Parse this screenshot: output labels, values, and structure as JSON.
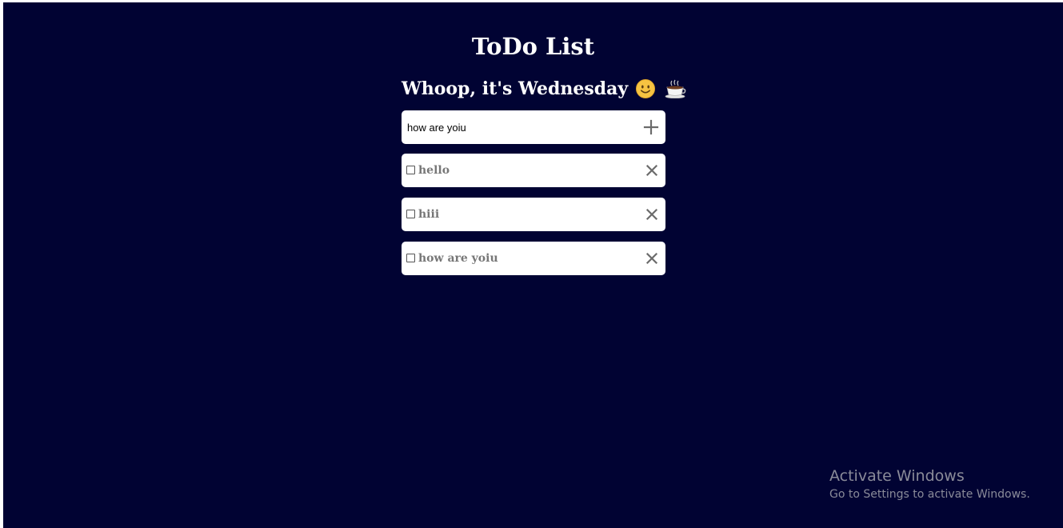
{
  "header": {
    "title": "ToDo List",
    "greeting": "Whoop, it's Wednesday",
    "emoji_face": "slightly-smiling-face-icon",
    "emoji_cup": "hot-beverage-icon"
  },
  "new_todo": {
    "value": "how are yoiu",
    "add_icon": "plus-icon"
  },
  "todos": [
    {
      "text": "hello",
      "checked": false
    },
    {
      "text": "hiii",
      "checked": false
    },
    {
      "text": "how are yoiu",
      "checked": false
    }
  ],
  "watermark": {
    "title": "Activate Windows",
    "subtitle": "Go to Settings to activate Windows."
  },
  "colors": {
    "background": "#010333",
    "card": "#ffffff",
    "item_text": "#777777",
    "icon": "#6b6b6b"
  }
}
